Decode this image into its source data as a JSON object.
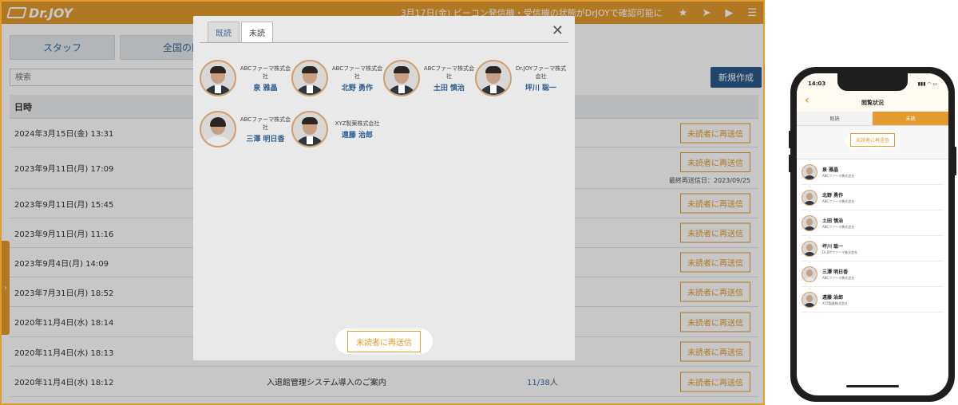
{
  "app": {
    "logo": "Dr.JOY",
    "ticker": "3月17日(金) ビーコン発信機・受信機の状態がDrJOYで確認可能に",
    "icons": [
      "star-icon",
      "send-icon",
      "video-icon",
      "menu-icon"
    ]
  },
  "background": {
    "tabs": [
      "スタッフ",
      "全国の医療者"
    ],
    "search_placeholder": "検索",
    "new_button": "新規作成",
    "table_header_date": "日時",
    "rows": [
      {
        "date": "2024年3月15日(金) 13:31",
        "title": "",
        "count": "",
        "resend": "未読者に再送信",
        "last_sent": ""
      },
      {
        "date": "2023年9月11日(月) 17:09",
        "title": "",
        "count": "",
        "resend": "未読者に再送信",
        "last_sent": "最終再送信日：2023/09/25"
      },
      {
        "date": "2023年9月11日(月) 15:45",
        "title": "",
        "count": "",
        "resend": "未読者に再送信",
        "last_sent": ""
      },
      {
        "date": "2023年9月11日(月) 11:16",
        "title": "",
        "count": "",
        "resend": "未読者に再送信",
        "last_sent": ""
      },
      {
        "date": "2023年9月4日(月) 14:09",
        "title": "",
        "count": "",
        "resend": "未読者に再送信",
        "last_sent": ""
      },
      {
        "date": "2023年7月31日(月) 18:52",
        "title": "",
        "count": "",
        "resend": "未読者に再送信",
        "last_sent": ""
      },
      {
        "date": "2020年11月4日(水) 18:14",
        "title": "",
        "count": "",
        "resend": "未読者に再送信",
        "last_sent": ""
      },
      {
        "date": "2020年11月4日(水) 18:13",
        "title": "",
        "count": "",
        "resend": "未読者に再送信",
        "last_sent": ""
      },
      {
        "date": "2020年11月4日(水) 18:12",
        "title": "入退館管理システム導入のご案内",
        "count": "11/38人",
        "resend": "未読者に再送信",
        "last_sent": ""
      }
    ],
    "side_handle": "›"
  },
  "modal": {
    "tabs": [
      "既読",
      "未読"
    ],
    "active_tab": "未読",
    "close": "✕",
    "members": [
      {
        "company": "ABCファーマ株式会社",
        "name": "泉 雅晶"
      },
      {
        "company": "ABCファーマ株式会社",
        "name": "北野 勇作"
      },
      {
        "company": "ABCファーマ株式会社",
        "name": "土田 慎治"
      },
      {
        "company": "Dr.JOYファーマ株式会社",
        "name": "坪川 聡一"
      },
      {
        "company": "ABCファーマ株式会社",
        "name": "三澤 明日香"
      },
      {
        "company": "XYZ製薬株式会社",
        "name": "遠藤 治郎"
      }
    ],
    "resend_button": "未読者に再送信"
  },
  "phone": {
    "time": "14:03",
    "status_icons": "▮▮▮ ◠ ▭",
    "back": "‹",
    "title": "閲覧状況",
    "tabs": [
      "既読",
      "未読"
    ],
    "resend_button": "未読者に再送信",
    "list": [
      {
        "name": "泉 雅晶",
        "company": "ABCファーマ株式会社"
      },
      {
        "name": "北野 勇作",
        "company": "ABCファーマ株式会社"
      },
      {
        "name": "土田 慎治",
        "company": "ABCファーマ株式会社"
      },
      {
        "name": "坪川 聡一",
        "company": "Dr.JOYファーマ株式会社"
      },
      {
        "name": "三澤 明日香",
        "company": "ABCファーマ株式会社"
      },
      {
        "name": "遠藤 治郎",
        "company": "XYZ製薬株式会社"
      }
    ]
  }
}
